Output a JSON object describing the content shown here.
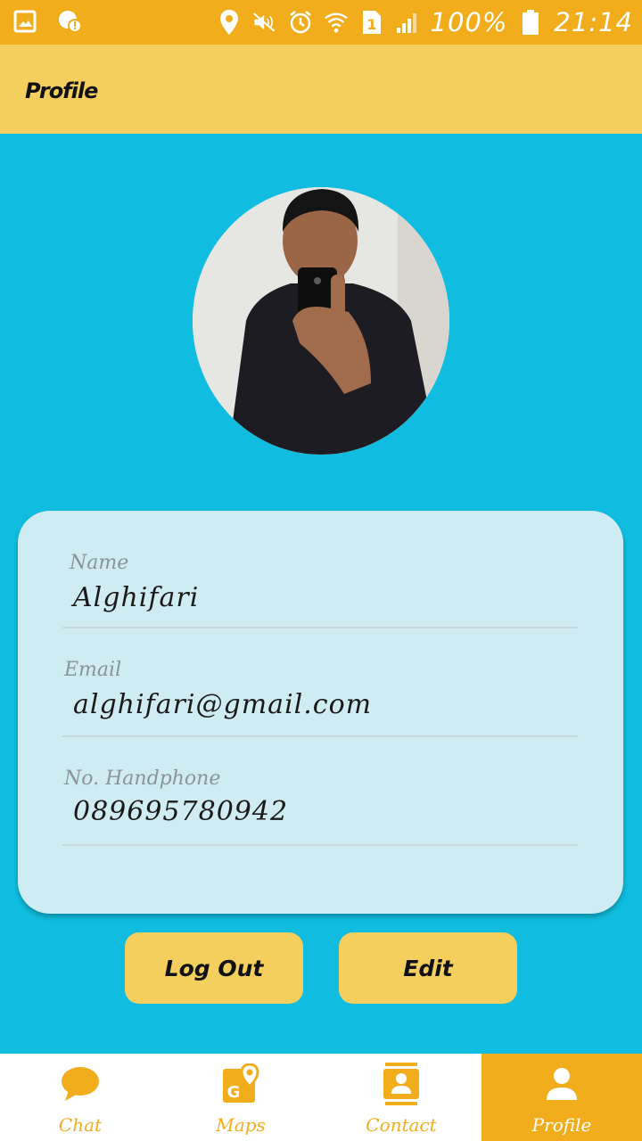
{
  "status_bar": {
    "battery": "100%",
    "time": "21:14",
    "sim_slot": "1",
    "icons": [
      "gallery-icon",
      "notification-badge-icon",
      "location-icon",
      "mute-icon",
      "alarm-icon",
      "wifi-icon",
      "sim-icon",
      "signal-icon",
      "battery-icon"
    ]
  },
  "app_bar": {
    "title": "Profile"
  },
  "profile": {
    "fields": [
      {
        "label": "Name",
        "value": "Alghifari"
      },
      {
        "label": "Email",
        "value": "alghifari@gmail.com"
      },
      {
        "label": "No. Handphone",
        "value": "089695780942"
      }
    ]
  },
  "buttons": {
    "logout": "Log Out",
    "edit": "Edit"
  },
  "bottom_nav": {
    "items": [
      {
        "label": "Chat",
        "icon": "chat-icon",
        "active": false
      },
      {
        "label": "Maps",
        "icon": "maps-icon",
        "active": false
      },
      {
        "label": "Contact",
        "icon": "contact-icon",
        "active": false
      },
      {
        "label": "Profile",
        "icon": "profile-icon",
        "active": true
      }
    ]
  },
  "colors": {
    "status_bar": "#f2ad1d",
    "app_bar": "#f4cf5e",
    "background": "#10bde0",
    "card": "#d0ecf3",
    "accent": "#f2ad1d"
  }
}
